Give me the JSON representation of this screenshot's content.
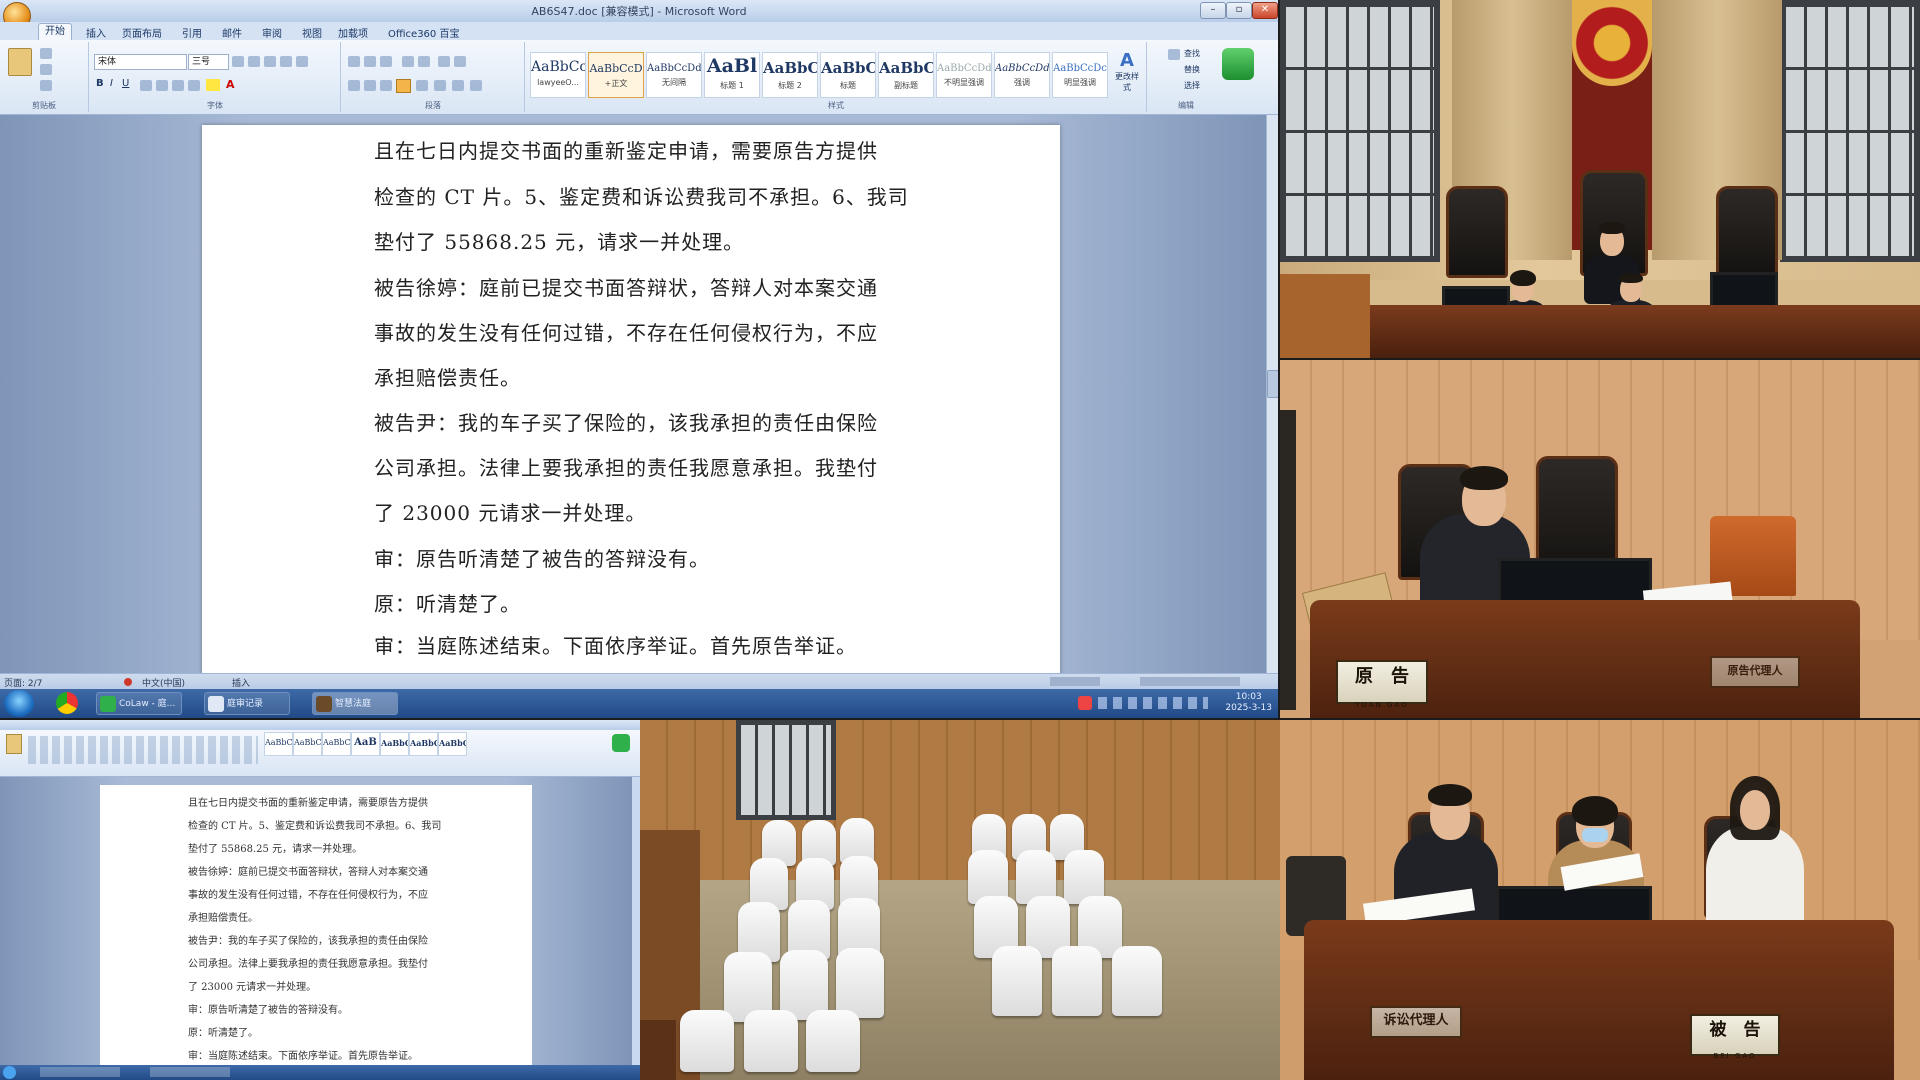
{
  "word_main": {
    "title": "AB6S47.doc [兼容模式] - Microsoft Word",
    "tabs": [
      "开始",
      "插入",
      "页面布局",
      "引用",
      "邮件",
      "审阅",
      "视图",
      "加载项",
      "Office360 百宝"
    ],
    "font_name": "宋体",
    "font_size": "三号",
    "styles": [
      {
        "sample": "AaBbCc",
        "name": "lawyeeO..."
      },
      {
        "sample": "AaBbCcD",
        "name": "+正文"
      },
      {
        "sample": "AaBbCcDd",
        "name": "无间隔"
      },
      {
        "sample": "AaBl",
        "name": "标题 1"
      },
      {
        "sample": "AaBbC",
        "name": "标题 2"
      },
      {
        "sample": "AaBbC",
        "name": "标题"
      },
      {
        "sample": "AaBbC",
        "name": "副标题"
      },
      {
        "sample": "AaBbCcDd",
        "name": "不明显强调"
      },
      {
        "sample": "AaBbCcDd",
        "name": "强调"
      },
      {
        "sample": "AaBbCcDc",
        "name": "明显强调"
      }
    ],
    "change_styles": "更改样式",
    "group_labels": [
      "剪贴板",
      "字体",
      "段落",
      "样式",
      "编辑"
    ],
    "edit_items": [
      "查找",
      "替换",
      "选择"
    ],
    "document_lines": [
      "且在七日内提交书面的重新鉴定申请，需要原告方提供",
      "检查的 CT 片。5、鉴定费和诉讼费我司不承担。6、我司",
      "垫付了 55868.25 元，请求一并处理。",
      " 被告徐婷：庭前已提交书面答辩状，答辩人对本案交通",
      "事故的发生没有任何过错，不存在任何侵权行为，不应",
      "承担赔偿责任。",
      " 被告尹：我的车子买了保险的，该我承担的责任由保险",
      "公司承担。法律上要我承担的责任我愿意承担。我垫付",
      "了 23000 元请求一并处理。",
      " 审：原告听清楚了被告的答辩没有。",
      " 原：听清楚了。",
      " 审：当庭陈述结束。下面依序举证。首先原告举证。"
    ],
    "status": {
      "page": "页面: 2/7",
      "lang": "中文(中国)",
      "mode": "插入"
    },
    "taskbar": {
      "items": [
        "CoLaw - 庭...",
        "庭审记录",
        "智慧法庭"
      ],
      "time": "10:03",
      "date": "2025-3-13"
    }
  },
  "word_small": {
    "styles": [
      "AaBbCc",
      "AaBbCcD",
      "AaBbCcD",
      "AaB",
      "AaBbC",
      "AaBbC",
      "AaBbC"
    ],
    "document_lines": [
      "且在七日内提交书面的重新鉴定申请，需要原告方提供",
      "检查的 CT 片。5、鉴定费和诉讼费我司不承担。6、我司",
      "垫付了 55868.25 元，请求一并处理。",
      " 被告徐婷：庭前已提交书面答辩状，答辩人对本案交通",
      "事故的发生没有任何过错，不存在任何侵权行为，不应",
      "承担赔偿责任。",
      " 被告尹：我的车子买了保险的，该我承担的责任由保险",
      "公司承担。法律上要我承担的责任我愿意承担。我垫付",
      "了 23000 元请求一并处理。",
      " 审：原告听清楚了被告的答辩没有。",
      " 原：听清楚了。",
      " 审：当庭陈述结束。下面依序举证。首先原告举证。"
    ]
  },
  "courtroom": {
    "plaintiff_plate": "原　告",
    "plaintiff_pinyin": "YUAN GAO",
    "plaintiff_agent_plate": "原告代理人",
    "defendant_plate": "被　告",
    "defendant_pinyin": "BEI GAO",
    "defendant_agent_plate": "诉讼代理人"
  }
}
